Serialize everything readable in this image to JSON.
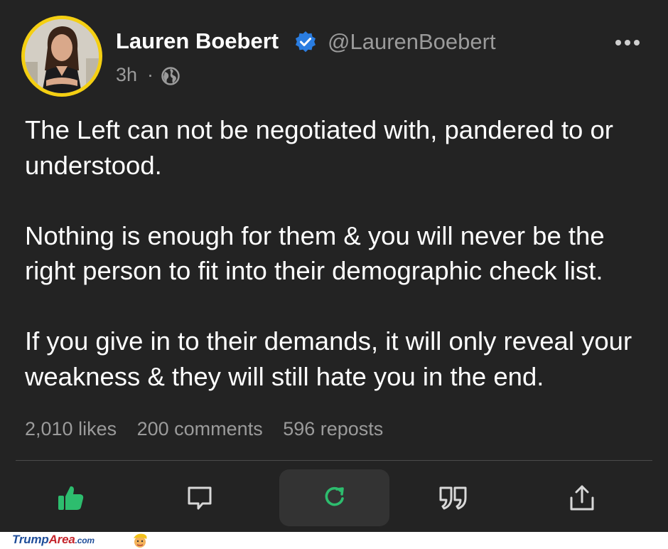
{
  "post": {
    "author_name": "Lauren Boebert",
    "handle": "@LaurenBoebert",
    "time": "3h",
    "separator": "·",
    "paragraphs": [
      "The Left can not be negotiated with, pandered to or understood.",
      "Nothing is enough for them & you will never be the right person to fit into their demographic check list.",
      "If you give in to their demands, it will only reveal your weakness & they will still hate you in the end."
    ],
    "stats": {
      "likes": "2,010 likes",
      "comments": "200 comments",
      "reposts": "596 reposts"
    }
  },
  "icons": {
    "verified": "verified-badge-icon",
    "more": "more-options-icon",
    "visibility": "globe-icon",
    "like": "thumbs-up-icon",
    "comment": "comment-icon",
    "repost": "repost-icon",
    "quote": "quote-icon",
    "share": "share-icon"
  },
  "colors": {
    "background": "#232323",
    "secondary_text": "#9b9b9b",
    "accent_green": "#2dbd6e",
    "verified_blue": "#2a7de1",
    "avatar_ring": "#f4cf12"
  },
  "watermark": {
    "brand_part1": "Trump",
    "brand_part2": "Area",
    "brand_part3": ".com"
  }
}
